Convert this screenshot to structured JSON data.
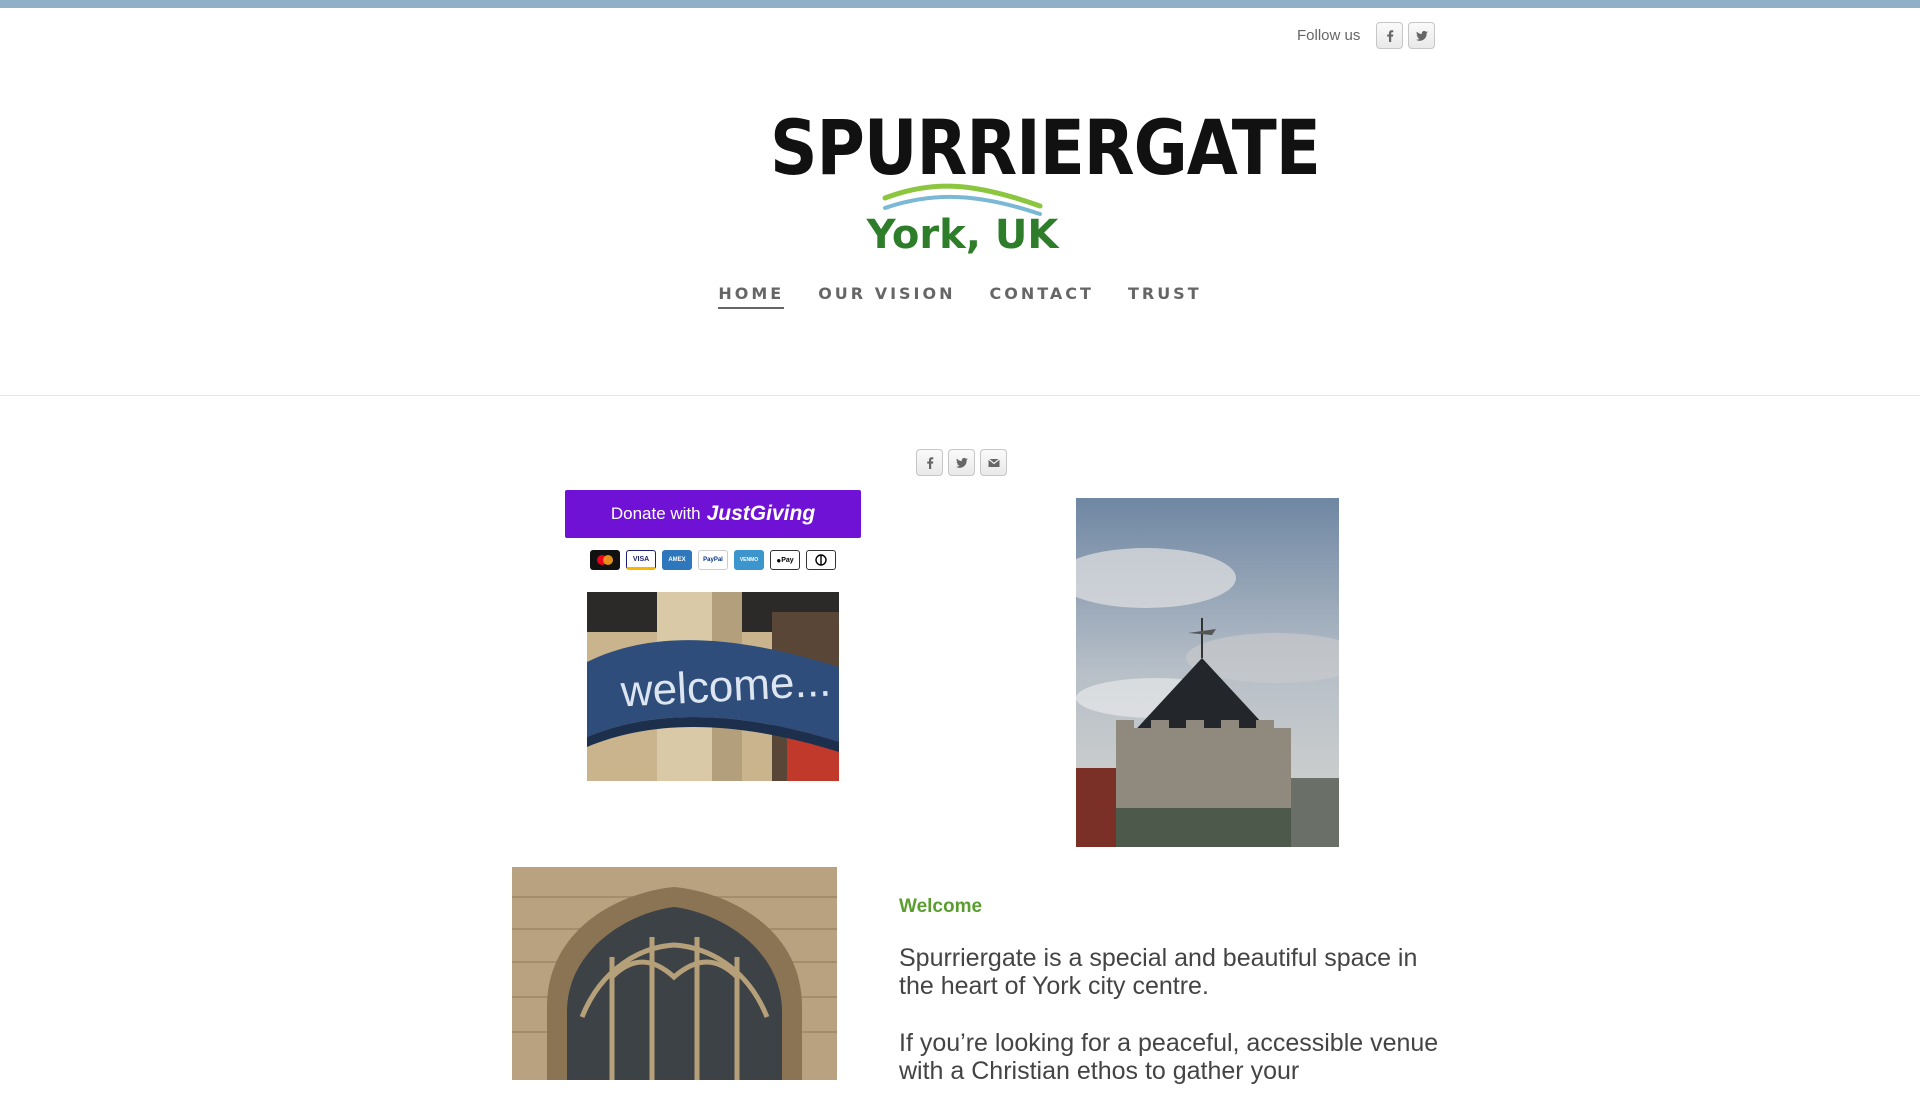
{
  "header": {
    "follow_label": "Follow us",
    "social": [
      "facebook-icon",
      "twitter-icon"
    ]
  },
  "logo": {
    "title": "SPURRIERGATE",
    "subtitle": "York, UK"
  },
  "nav": {
    "items": [
      {
        "label": "HOME",
        "active": true
      },
      {
        "label": "OUR VISION",
        "active": false
      },
      {
        "label": "CONTACT",
        "active": false
      },
      {
        "label": "TRUST",
        "active": false
      }
    ]
  },
  "share": [
    "facebook-icon",
    "twitter-icon",
    "email-icon"
  ],
  "donate": {
    "prefix": "Donate with",
    "brand": "JustGiving",
    "brand_color": "#6f12d6",
    "payment_methods": [
      "mastercard",
      "VISA",
      "AMEX",
      "PayPal",
      "VENMO",
      "Pay",
      "diners"
    ]
  },
  "images": {
    "welcome_sign_text": "welcome..."
  },
  "content": {
    "heading": "Welcome",
    "heading_color": "#5a9e2f",
    "paragraphs": [
      "Spurriergate is a special and beautiful space in the heart of York city centre.",
      "If you’re looking for a peaceful, accessible venue with a Christian ethos to gather your"
    ]
  }
}
